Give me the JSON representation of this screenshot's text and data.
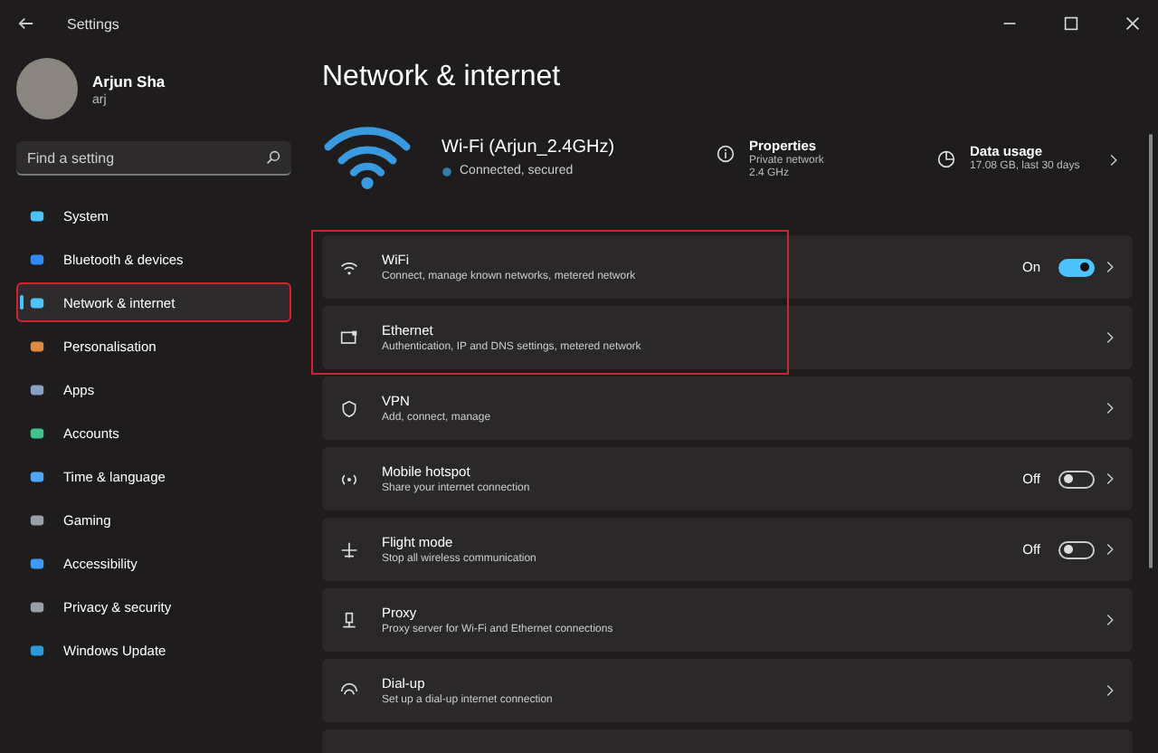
{
  "window": {
    "title": "Settings"
  },
  "profile": {
    "name": "Arjun Sha",
    "account": "arj"
  },
  "search": {
    "placeholder": "Find a setting"
  },
  "sidebar": {
    "items": [
      {
        "label": "System",
        "selected": false,
        "highlighted": false
      },
      {
        "label": "Bluetooth & devices",
        "selected": false,
        "highlighted": false
      },
      {
        "label": "Network & internet",
        "selected": true,
        "highlighted": true
      },
      {
        "label": "Personalisation",
        "selected": false,
        "highlighted": false
      },
      {
        "label": "Apps",
        "selected": false,
        "highlighted": false
      },
      {
        "label": "Accounts",
        "selected": false,
        "highlighted": false
      },
      {
        "label": "Time & language",
        "selected": false,
        "highlighted": false
      },
      {
        "label": "Gaming",
        "selected": false,
        "highlighted": false
      },
      {
        "label": "Accessibility",
        "selected": false,
        "highlighted": false
      },
      {
        "label": "Privacy & security",
        "selected": false,
        "highlighted": false
      },
      {
        "label": "Windows Update",
        "selected": false,
        "highlighted": false
      }
    ]
  },
  "page": {
    "title": "Network & internet"
  },
  "connection": {
    "name": "Wi-Fi (Arjun_2.4GHz)",
    "status": "Connected, secured",
    "properties": {
      "title": "Properties",
      "lines": [
        "Private network",
        "2.4 GHz"
      ]
    },
    "data_usage": {
      "title": "Data usage",
      "detail": "17.08 GB, last 30 days"
    }
  },
  "cards": [
    {
      "kind": "toggle",
      "title": "WiFi",
      "subtitle": "Connect, manage known networks, metered network",
      "on": true,
      "state_label": "On",
      "highlighted": true
    },
    {
      "kind": "link",
      "title": "Ethernet",
      "subtitle": "Authentication, IP and DNS settings, metered network",
      "highlighted": true
    },
    {
      "kind": "link",
      "title": "VPN",
      "subtitle": "Add, connect, manage",
      "highlighted": false
    },
    {
      "kind": "toggle",
      "title": "Mobile hotspot",
      "subtitle": "Share your internet connection",
      "on": false,
      "state_label": "Off",
      "highlighted": false
    },
    {
      "kind": "toggle",
      "title": "Flight mode",
      "subtitle": "Stop all wireless communication",
      "on": false,
      "state_label": "Off",
      "highlighted": false
    },
    {
      "kind": "link",
      "title": "Proxy",
      "subtitle": "Proxy server for Wi-Fi and Ethernet connections",
      "highlighted": false
    },
    {
      "kind": "link",
      "title": "Dial-up",
      "subtitle": "Set up a dial-up internet connection",
      "highlighted": false
    }
  ]
}
